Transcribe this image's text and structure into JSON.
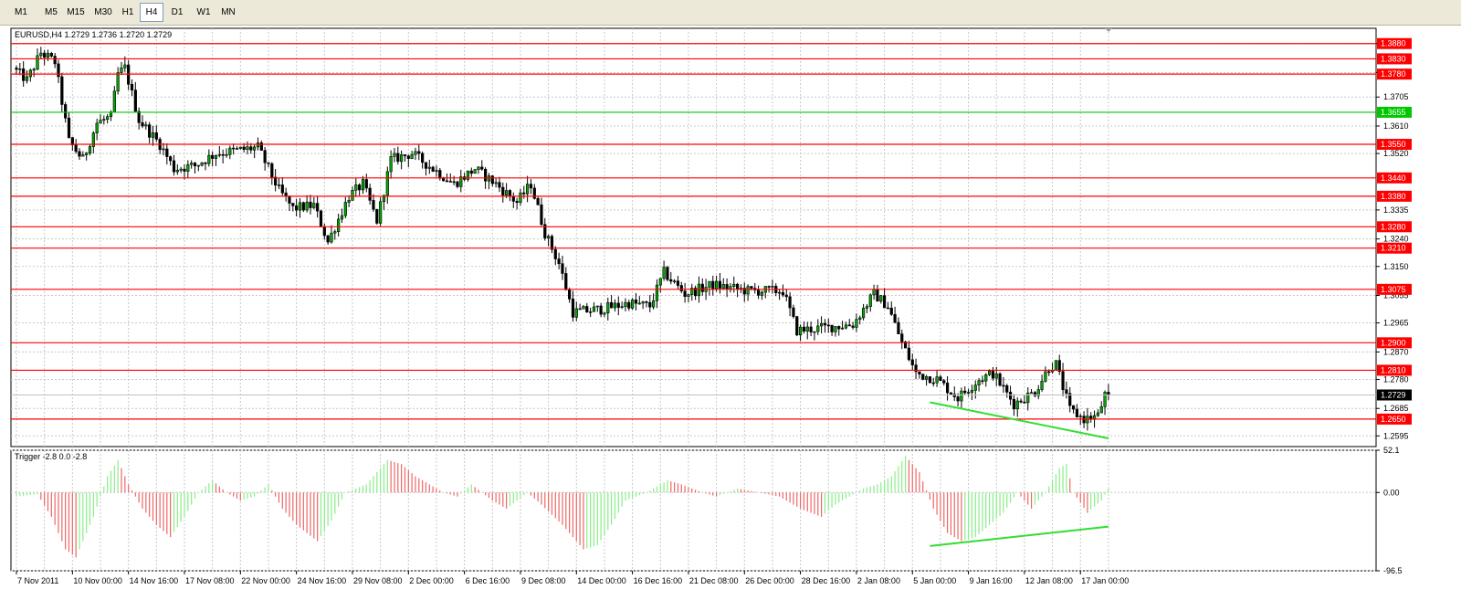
{
  "toolbar": {
    "timeframes": [
      {
        "label": "M1",
        "active": false
      },
      {
        "label": "M5",
        "active": false
      },
      {
        "label": "M15",
        "active": false
      },
      {
        "label": "M30",
        "active": false
      },
      {
        "label": "H1",
        "active": false
      },
      {
        "label": "H4",
        "active": true
      },
      {
        "label": "D1",
        "active": false
      },
      {
        "label": "W1",
        "active": false
      },
      {
        "label": "MN",
        "active": false
      }
    ]
  },
  "colors": {
    "resistance": "#ff0000",
    "support_major": "#00c800",
    "bull_candle": "#00aa00",
    "bear_candle": "#000000",
    "osc_positive": "#88ee88",
    "osc_negative": "#ee6666",
    "grid": "#c8c8c8",
    "trendline": "#33dd33",
    "current_price_bg": "#000000"
  },
  "chart_data": [
    {
      "type": "line",
      "title": "EURUSD,H4  1.2729 1.2736 1.2720 1.2729",
      "ylim": [
        1.256,
        1.393
      ],
      "y_ticks": [
        {
          "label": "1.3880",
          "value": 1.388
        },
        {
          "label": "1.3785",
          "value": 1.3785
        },
        {
          "label": "1.3705",
          "value": 1.3705
        },
        {
          "label": "1.3610",
          "value": 1.361
        },
        {
          "label": "1.3520",
          "value": 1.352
        },
        {
          "label": "1.3335",
          "value": 1.3335
        },
        {
          "label": "1.3240",
          "value": 1.324
        },
        {
          "label": "1.3150",
          "value": 1.315
        },
        {
          "label": "1.3055",
          "value": 1.3055
        },
        {
          "label": "1.2965",
          "value": 1.2965
        },
        {
          "label": "1.2870",
          "value": 1.287
        },
        {
          "label": "1.2780",
          "value": 1.278
        },
        {
          "label": "1.2685",
          "value": 1.2685
        },
        {
          "label": "1.2595",
          "value": 1.2595
        }
      ],
      "x_labels": [
        {
          "label": "7 Nov 2011",
          "bar": 0
        },
        {
          "label": "10 Nov 00:00",
          "bar": 16
        },
        {
          "label": "14 Nov 16:00",
          "bar": 32
        },
        {
          "label": "17 Nov 08:00",
          "bar": 48
        },
        {
          "label": "22 Nov 00:00",
          "bar": 64
        },
        {
          "label": "24 Nov 16:00",
          "bar": 80
        },
        {
          "label": "29 Nov 08:00",
          "bar": 96
        },
        {
          "label": "2 Dec 00:00",
          "bar": 112
        },
        {
          "label": "6 Dec 16:00",
          "bar": 128
        },
        {
          "label": "9 Dec 08:00",
          "bar": 144
        },
        {
          "label": "14 Dec 00:00",
          "bar": 160
        },
        {
          "label": "16 Dec 16:00",
          "bar": 176
        },
        {
          "label": "21 Dec 08:00",
          "bar": 192
        },
        {
          "label": "26 Dec 00:00",
          "bar": 208
        },
        {
          "label": "28 Dec 16:00",
          "bar": 224
        },
        {
          "label": "2 Jan 08:00",
          "bar": 240
        },
        {
          "label": "5 Jan 00:00",
          "bar": 256
        },
        {
          "label": "9 Jan 16:00",
          "bar": 272
        },
        {
          "label": "12 Jan 08:00",
          "bar": 288
        },
        {
          "label": "17 Jan 00:00",
          "bar": 304
        }
      ],
      "horizontal_levels": [
        {
          "label": "1.3880",
          "value": 1.388,
          "kind": "resistance"
        },
        {
          "label": "1.3830",
          "value": 1.383,
          "kind": "resistance"
        },
        {
          "label": "1.3780",
          "value": 1.378,
          "kind": "resistance"
        },
        {
          "label": "1.3655",
          "value": 1.3655,
          "kind": "support_major"
        },
        {
          "label": "1.3550",
          "value": 1.355,
          "kind": "resistance"
        },
        {
          "label": "1.3440",
          "value": 1.344,
          "kind": "resistance"
        },
        {
          "label": "1.3380",
          "value": 1.338,
          "kind": "resistance"
        },
        {
          "label": "1.3280",
          "value": 1.328,
          "kind": "resistance"
        },
        {
          "label": "1.3210",
          "value": 1.321,
          "kind": "resistance"
        },
        {
          "label": "1.3075",
          "value": 1.3075,
          "kind": "resistance"
        },
        {
          "label": "1.2900",
          "value": 1.29,
          "kind": "resistance"
        },
        {
          "label": "1.2810",
          "value": 1.281,
          "kind": "resistance"
        },
        {
          "label": "1.2650",
          "value": 1.265,
          "kind": "resistance"
        }
      ],
      "current_price": {
        "label": "1.2729",
        "value": 1.2729
      },
      "price_keypoints": [
        [
          0,
          1.38
        ],
        [
          4,
          1.376
        ],
        [
          8,
          1.385
        ],
        [
          12,
          1.382
        ],
        [
          16,
          1.356
        ],
        [
          20,
          1.35
        ],
        [
          24,
          1.362
        ],
        [
          28,
          1.364
        ],
        [
          30,
          1.378
        ],
        [
          32,
          1.38
        ],
        [
          36,
          1.363
        ],
        [
          42,
          1.355
        ],
        [
          46,
          1.347
        ],
        [
          52,
          1.348
        ],
        [
          58,
          1.352
        ],
        [
          64,
          1.353
        ],
        [
          70,
          1.354
        ],
        [
          76,
          1.34
        ],
        [
          80,
          1.334
        ],
        [
          86,
          1.335
        ],
        [
          90,
          1.323
        ],
        [
          96,
          1.338
        ],
        [
          100,
          1.342
        ],
        [
          104,
          1.33
        ],
        [
          108,
          1.35
        ],
        [
          114,
          1.352
        ],
        [
          120,
          1.347
        ],
        [
          126,
          1.342
        ],
        [
          132,
          1.347
        ],
        [
          138,
          1.342
        ],
        [
          144,
          1.336
        ],
        [
          148,
          1.342
        ],
        [
          152,
          1.326
        ],
        [
          156,
          1.316
        ],
        [
          160,
          1.3
        ],
        [
          168,
          1.301
        ],
        [
          176,
          1.303
        ],
        [
          182,
          1.302
        ],
        [
          186,
          1.313
        ],
        [
          192,
          1.306
        ],
        [
          200,
          1.309
        ],
        [
          210,
          1.307
        ],
        [
          220,
          1.307
        ],
        [
          224,
          1.294
        ],
        [
          232,
          1.295
        ],
        [
          240,
          1.296
        ],
        [
          246,
          1.306
        ],
        [
          250,
          1.302
        ],
        [
          254,
          1.29
        ],
        [
          258,
          1.28
        ],
        [
          264,
          1.278
        ],
        [
          270,
          1.272
        ],
        [
          276,
          1.278
        ],
        [
          280,
          1.28
        ],
        [
          286,
          1.27
        ],
        [
          292,
          1.274
        ],
        [
          296,
          1.282
        ],
        [
          298,
          1.283
        ],
        [
          302,
          1.268
        ],
        [
          306,
          1.265
        ],
        [
          310,
          1.266
        ],
        [
          312,
          1.2729
        ]
      ],
      "trendlines": [
        {
          "from": [
            261,
            1.2705
          ],
          "to": [
            312,
            1.2587
          ]
        }
      ]
    },
    {
      "type": "bar",
      "title": "Trigger -2.8 0.0 -2.8",
      "ylim": [
        -96.5,
        52.1
      ],
      "y_ticks": [
        {
          "label": "52.1",
          "value": 52.1
        },
        {
          "label": "0.00",
          "value": 0.0
        },
        {
          "label": "-96.5",
          "value": -96.5
        }
      ],
      "keypoints": [
        [
          0,
          -5
        ],
        [
          6,
          -2
        ],
        [
          10,
          -30
        ],
        [
          14,
          -70
        ],
        [
          17,
          -80
        ],
        [
          22,
          -30
        ],
        [
          26,
          20
        ],
        [
          29,
          40
        ],
        [
          32,
          10
        ],
        [
          36,
          -20
        ],
        [
          40,
          -40
        ],
        [
          44,
          -55
        ],
        [
          48,
          -30
        ],
        [
          52,
          0
        ],
        [
          56,
          15
        ],
        [
          60,
          0
        ],
        [
          64,
          -10
        ],
        [
          68,
          -5
        ],
        [
          72,
          10
        ],
        [
          76,
          -20
        ],
        [
          80,
          -40
        ],
        [
          86,
          -60
        ],
        [
          90,
          -35
        ],
        [
          94,
          0
        ],
        [
          100,
          10
        ],
        [
          106,
          40
        ],
        [
          110,
          35
        ],
        [
          114,
          20
        ],
        [
          118,
          10
        ],
        [
          122,
          0
        ],
        [
          126,
          -5
        ],
        [
          130,
          10
        ],
        [
          136,
          -10
        ],
        [
          140,
          -20
        ],
        [
          146,
          0
        ],
        [
          150,
          -15
        ],
        [
          156,
          -40
        ],
        [
          162,
          -70
        ],
        [
          166,
          -65
        ],
        [
          170,
          -40
        ],
        [
          174,
          -10
        ],
        [
          180,
          0
        ],
        [
          186,
          15
        ],
        [
          190,
          10
        ],
        [
          196,
          0
        ],
        [
          200,
          -5
        ],
        [
          206,
          5
        ],
        [
          212,
          0
        ],
        [
          218,
          -5
        ],
        [
          224,
          -20
        ],
        [
          230,
          -30
        ],
        [
          234,
          -15
        ],
        [
          238,
          -5
        ],
        [
          242,
          5
        ],
        [
          246,
          10
        ],
        [
          250,
          20
        ],
        [
          254,
          45
        ],
        [
          258,
          25
        ],
        [
          262,
          -20
        ],
        [
          266,
          -50
        ],
        [
          270,
          -60
        ],
        [
          274,
          -55
        ],
        [
          278,
          -40
        ],
        [
          282,
          -25
        ],
        [
          286,
          0
        ],
        [
          290,
          -20
        ],
        [
          294,
          0
        ],
        [
          298,
          30
        ],
        [
          300,
          35
        ],
        [
          302,
          0
        ],
        [
          306,
          -25
        ],
        [
          310,
          -10
        ],
        [
          312,
          5
        ]
      ],
      "trendlines": [
        {
          "from": [
            261,
            -66
          ],
          "to": [
            312,
            -42
          ]
        }
      ]
    }
  ]
}
